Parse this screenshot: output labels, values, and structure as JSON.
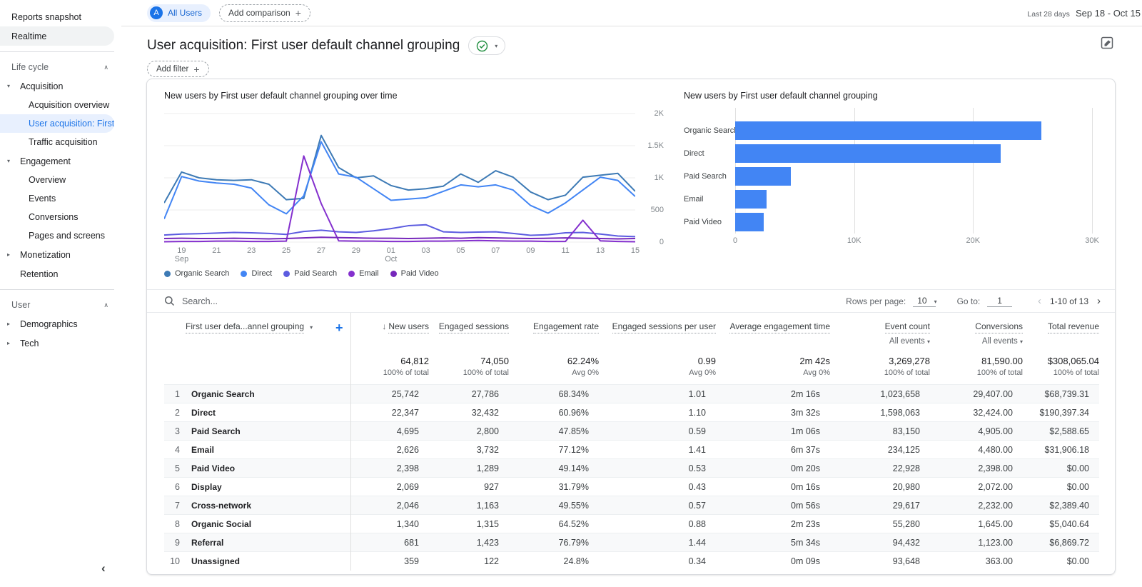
{
  "icons": {
    "caret_expanded": "▾",
    "caret_collapsed": "▸",
    "chevron_up": "∧",
    "caret_down": "▾",
    "plus": "+",
    "sort_desc": "↓",
    "chevron_left": "‹",
    "chevron_right": "›",
    "collapse_sidebar": "‹"
  },
  "colors": {
    "accent": "#1a73e8",
    "selected_bg": "#e8f0fe",
    "check_green": "#1e8e3e",
    "bar_blue": "#4285f4"
  },
  "sidebar": {
    "reports_snapshot": "Reports snapshot",
    "realtime": "Realtime",
    "life_cycle_title": "Life cycle",
    "acquisition": {
      "label": "Acquisition",
      "children": [
        "Acquisition overview",
        "User acquisition: First user ...",
        "Traffic acquisition"
      ]
    },
    "engagement": {
      "label": "Engagement",
      "children": [
        "Overview",
        "Events",
        "Conversions",
        "Pages and screens"
      ]
    },
    "monetization": "Monetization",
    "retention": "Retention",
    "user_title": "User",
    "demographics": "Demographics",
    "tech": "Tech"
  },
  "header": {
    "audience_avatar": "A",
    "audience": "All Users",
    "add_comparison": "Add comparison",
    "date_preset": "Last 28 days",
    "date_range": "Sep 18 - Oct 15",
    "title": "User acquisition: First user default channel grouping",
    "add_filter": "Add filter"
  },
  "chart_data": [
    {
      "type": "line",
      "title": "New users by First user default channel grouping over time",
      "x": [
        "Sep 18",
        "Sep 19",
        "Sep 20",
        "Sep 21",
        "Sep 22",
        "Sep 23",
        "Sep 24",
        "Sep 25",
        "Sep 26",
        "Sep 27",
        "Sep 28",
        "Sep 29",
        "Sep 30",
        "Oct 01",
        "Oct 02",
        "Oct 03",
        "Oct 04",
        "Oct 05",
        "Oct 06",
        "Oct 07",
        "Oct 08",
        "Oct 09",
        "Oct 10",
        "Oct 11",
        "Oct 12",
        "Oct 13",
        "Oct 14",
        "Oct 15"
      ],
      "ylim": [
        0,
        2000
      ],
      "y_ticks": [
        {
          "v": 2000,
          "label": "2K"
        },
        {
          "v": 1500,
          "label": "1.5K"
        },
        {
          "v": 1000,
          "label": "1K"
        },
        {
          "v": 500,
          "label": "500"
        },
        {
          "v": 0,
          "label": "0"
        }
      ],
      "x_ticks": [
        {
          "i": 1,
          "label": "19",
          "sub": "Sep"
        },
        {
          "i": 3,
          "label": "21"
        },
        {
          "i": 5,
          "label": "23"
        },
        {
          "i": 7,
          "label": "25"
        },
        {
          "i": 9,
          "label": "27"
        },
        {
          "i": 11,
          "label": "29"
        },
        {
          "i": 13,
          "label": "01",
          "sub": "Oct"
        },
        {
          "i": 15,
          "label": "03"
        },
        {
          "i": 17,
          "label": "05"
        },
        {
          "i": 19,
          "label": "07"
        },
        {
          "i": 21,
          "label": "09"
        },
        {
          "i": 23,
          "label": "11"
        },
        {
          "i": 25,
          "label": "13"
        },
        {
          "i": 27,
          "label": "15"
        }
      ],
      "series": [
        {
          "name": "Organic Search",
          "color": "#3d7ab5",
          "values": [
            610,
            1090,
            1000,
            970,
            960,
            970,
            900,
            660,
            680,
            1660,
            1160,
            1000,
            1030,
            880,
            810,
            830,
            870,
            1060,
            930,
            1110,
            1010,
            780,
            660,
            730,
            1010,
            1040,
            1070,
            790
          ]
        },
        {
          "name": "Direct",
          "color": "#4285f4",
          "values": [
            360,
            1020,
            950,
            920,
            900,
            840,
            580,
            440,
            720,
            1560,
            1060,
            1010,
            830,
            650,
            670,
            690,
            790,
            890,
            860,
            890,
            810,
            570,
            450,
            610,
            810,
            1010,
            960,
            710
          ]
        },
        {
          "name": "Paid Search",
          "color": "#5c5ce0",
          "values": [
            110,
            125,
            130,
            140,
            150,
            145,
            135,
            120,
            165,
            185,
            160,
            150,
            175,
            210,
            255,
            270,
            160,
            150,
            155,
            160,
            135,
            105,
            115,
            145,
            150,
            125,
            95,
            85
          ]
        },
        {
          "name": "Email",
          "color": "#8430ce",
          "values": [
            5,
            10,
            10,
            15,
            15,
            10,
            10,
            15,
            1340,
            600,
            20,
            15,
            15,
            10,
            10,
            15,
            15,
            20,
            25,
            20,
            15,
            15,
            10,
            10,
            340,
            20,
            10,
            5
          ]
        },
        {
          "name": "Paid Video",
          "color": "#7627bb",
          "values": [
            55,
            60,
            55,
            55,
            60,
            55,
            50,
            55,
            65,
            75,
            70,
            65,
            60,
            60,
            55,
            60,
            65,
            60,
            70,
            65,
            60,
            55,
            60,
            65,
            60,
            55,
            50,
            55
          ]
        }
      ]
    },
    {
      "type": "bar",
      "orientation": "horizontal",
      "title": "New users by First user default channel grouping",
      "categories": [
        "Organic Search",
        "Direct",
        "Paid Search",
        "Email",
        "Paid Video"
      ],
      "values": [
        25742,
        22347,
        4695,
        2626,
        2398
      ],
      "xlim": [
        0,
        30000
      ],
      "x_ticks": [
        {
          "pos": 0,
          "label": "0"
        },
        {
          "pos": 0.3333,
          "label": "10K"
        },
        {
          "pos": 0.6667,
          "label": "20K"
        },
        {
          "pos": 1,
          "label": "30K"
        }
      ],
      "bar_color": "#4285f4"
    }
  ],
  "toolbar": {
    "search_placeholder": "Search...",
    "rows_per_page_label": "Rows per page:",
    "rows_per_page_value": "10",
    "goto_label": "Go to:",
    "goto_value": "1",
    "range": "1-10 of 13"
  },
  "table": {
    "dimension_header": "First user defa...annel grouping",
    "columns": [
      "New users",
      "Engaged sessions",
      "Engagement rate",
      "Engaged sessions per user",
      "Average engagement time",
      "Event count",
      "Conversions",
      "Total revenue"
    ],
    "event_count_filter": "All events",
    "conversions_filter": "All events",
    "totals": {
      "values": [
        "64,812",
        "74,050",
        "62.24%",
        "0.99",
        "2m 42s",
        "3,269,278",
        "81,590.00",
        "$308,065.04"
      ],
      "subs": [
        "100% of total",
        "100% of total",
        "Avg 0%",
        "Avg 0%",
        "Avg 0%",
        "100% of total",
        "100% of total",
        "100% of total"
      ]
    },
    "rows": [
      {
        "n": "1",
        "channel": "Organic Search",
        "m": [
          "25,742",
          "27,786",
          "68.34%",
          "1.01",
          "2m 16s",
          "1,023,658",
          "29,407.00",
          "$68,739.31"
        ]
      },
      {
        "n": "2",
        "channel": "Direct",
        "m": [
          "22,347",
          "32,432",
          "60.96%",
          "1.10",
          "3m 32s",
          "1,598,063",
          "32,424.00",
          "$190,397.34"
        ]
      },
      {
        "n": "3",
        "channel": "Paid Search",
        "m": [
          "4,695",
          "2,800",
          "47.85%",
          "0.59",
          "1m 06s",
          "83,150",
          "4,905.00",
          "$2,588.65"
        ]
      },
      {
        "n": "4",
        "channel": "Email",
        "m": [
          "2,626",
          "3,732",
          "77.12%",
          "1.41",
          "6m 37s",
          "234,125",
          "4,480.00",
          "$31,906.18"
        ]
      },
      {
        "n": "5",
        "channel": "Paid Video",
        "m": [
          "2,398",
          "1,289",
          "49.14%",
          "0.53",
          "0m 20s",
          "22,928",
          "2,398.00",
          "$0.00"
        ]
      },
      {
        "n": "6",
        "channel": "Display",
        "m": [
          "2,069",
          "927",
          "31.79%",
          "0.43",
          "0m 16s",
          "20,980",
          "2,072.00",
          "$0.00"
        ]
      },
      {
        "n": "7",
        "channel": "Cross-network",
        "m": [
          "2,046",
          "1,163",
          "49.55%",
          "0.57",
          "0m 56s",
          "29,617",
          "2,232.00",
          "$2,389.40"
        ]
      },
      {
        "n": "8",
        "channel": "Organic Social",
        "m": [
          "1,340",
          "1,315",
          "64.52%",
          "0.88",
          "2m 23s",
          "55,280",
          "1,645.00",
          "$5,040.64"
        ]
      },
      {
        "n": "9",
        "channel": "Referral",
        "m": [
          "681",
          "1,423",
          "76.79%",
          "1.44",
          "5m 34s",
          "94,432",
          "1,123.00",
          "$6,869.72"
        ]
      },
      {
        "n": "10",
        "channel": "Unassigned",
        "m": [
          "359",
          "122",
          "24.8%",
          "0.34",
          "0m 09s",
          "93,648",
          "363.00",
          "$0.00"
        ]
      }
    ]
  }
}
